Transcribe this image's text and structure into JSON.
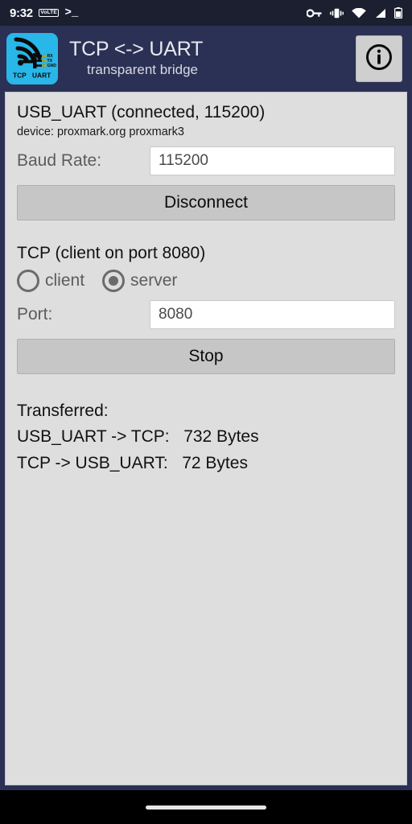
{
  "status_bar": {
    "clock": "9:32",
    "volte_badge": "VoLTE",
    "terminal_glyph": ">_",
    "icons": [
      "vpn-key-icon",
      "vibrate-icon",
      "wifi-icon",
      "cellular-signal-icon",
      "battery-icon"
    ]
  },
  "app_bar": {
    "title": "TCP <-> UART",
    "subtitle": "transparent bridge",
    "logo": {
      "pin_labels": [
        "RX",
        "TX",
        "GND"
      ],
      "caption_left": "TCP",
      "caption_right": "UART",
      "background_color": "#29b6e8"
    },
    "info_button_label": "i"
  },
  "usb_section": {
    "title": "USB_UART (connected, 115200)",
    "device_line": "device: proxmark.org proxmark3",
    "baud_label": "Baud Rate:",
    "baud_value": "115200",
    "action_button": "Disconnect"
  },
  "tcp_section": {
    "title": "TCP (client on port 8080)",
    "modes": [
      {
        "label": "client",
        "selected": false
      },
      {
        "label": "server",
        "selected": true
      }
    ],
    "port_label": "Port:",
    "port_value": "8080",
    "action_button": "Stop"
  },
  "transferred": {
    "heading": "Transferred:",
    "rows": [
      {
        "direction": "USB_UART -> TCP:",
        "value": "732 Bytes"
      },
      {
        "direction": "TCP -> USB_UART:",
        "value": "72 Bytes"
      }
    ]
  },
  "colors": {
    "app_bar": "#2b3154",
    "panel": "#dededf",
    "accent": "#29b6e8",
    "button": "#c6c6c6"
  }
}
